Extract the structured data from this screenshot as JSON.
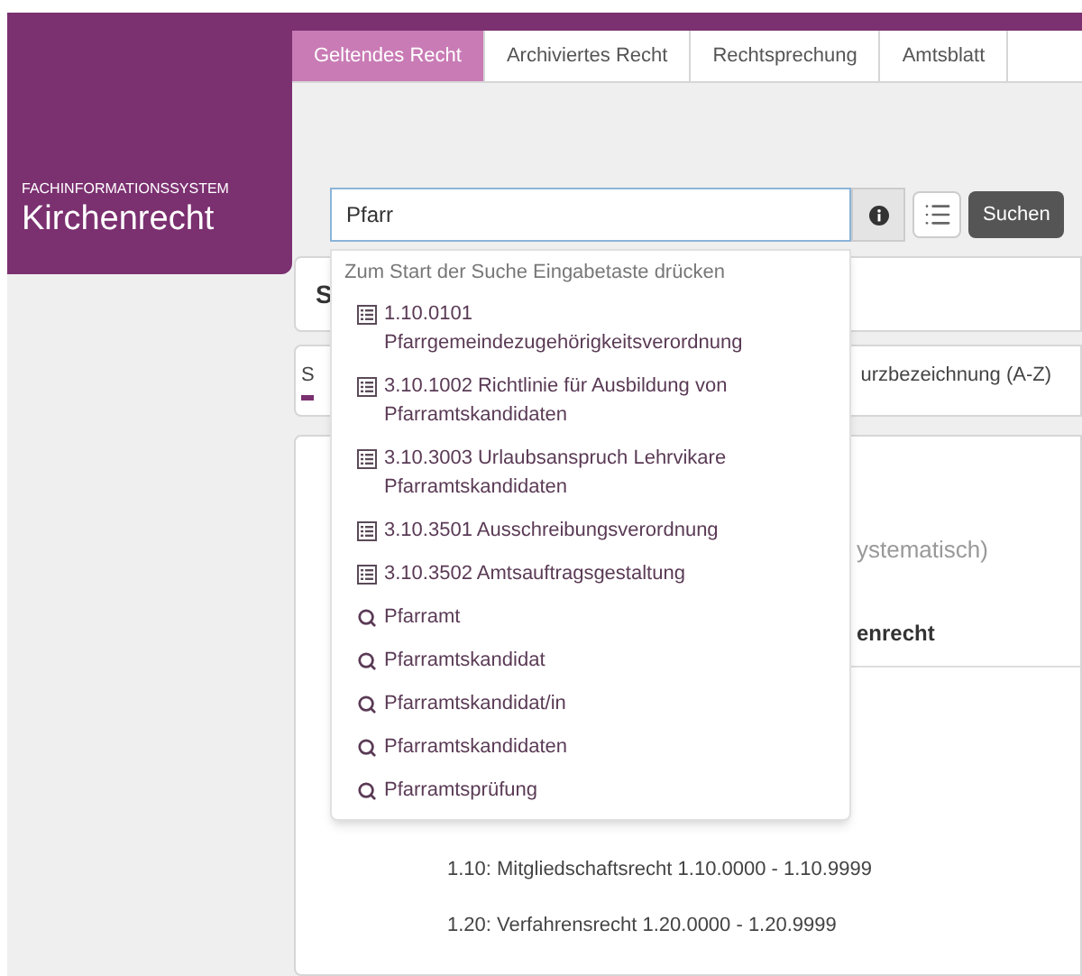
{
  "brand": {
    "subtitle": "FACHINFORMATIONSSYSTEM",
    "title": "Kirchenrecht"
  },
  "tabs": [
    {
      "label": "Geltendes Recht",
      "selected": true
    },
    {
      "label": "Archiviertes Recht",
      "selected": false
    },
    {
      "label": "Rechtsprechung",
      "selected": false
    },
    {
      "label": "Amtsblatt",
      "selected": false
    }
  ],
  "search": {
    "value": "Pfarr",
    "button": "Suchen"
  },
  "suggestions": {
    "hint": "Zum Start der Suche Eingabetaste drücken",
    "items": [
      {
        "kind": "document",
        "text": "1.10.0101 Pfarrgemeindezugehörigkeitsverordnung"
      },
      {
        "kind": "document",
        "text": "3.10.1002 Richtlinie für Ausbildung von Pfarramtskandidaten"
      },
      {
        "kind": "document",
        "text": "3.10.3003 Urlaubsanspruch Lehrvikare Pfarramtskandidaten"
      },
      {
        "kind": "document",
        "text": "3.10.3501 Ausschreibungsverordnung"
      },
      {
        "kind": "document",
        "text": "3.10.3502 Amtsauftragsgestaltung"
      },
      {
        "kind": "term",
        "text": "Pfarramt"
      },
      {
        "kind": "term",
        "text": "Pfarramtskandidat"
      },
      {
        "kind": "term",
        "text": "Pfarramtskandidat/in"
      },
      {
        "kind": "term",
        "text": "Pfarramtskandidaten"
      },
      {
        "kind": "term",
        "text": "Pfarramtsprüfung"
      }
    ]
  },
  "card_1": {
    "heading": "S"
  },
  "card_2": {
    "tabs": [
      {
        "label": "S",
        "selected": true
      },
      {
        "label": "urzbezeichnung (A-Z)",
        "selected": false
      }
    ]
  },
  "card_3": {
    "subtitle": "ystematisch)",
    "heading": "enrecht",
    "items": [
      "1.10: Mitgliedschaftsrecht 1.10.0000 - 1.10.9999",
      "1.20: Verfahrensrecht 1.20.0000 - 1.20.9999"
    ]
  }
}
